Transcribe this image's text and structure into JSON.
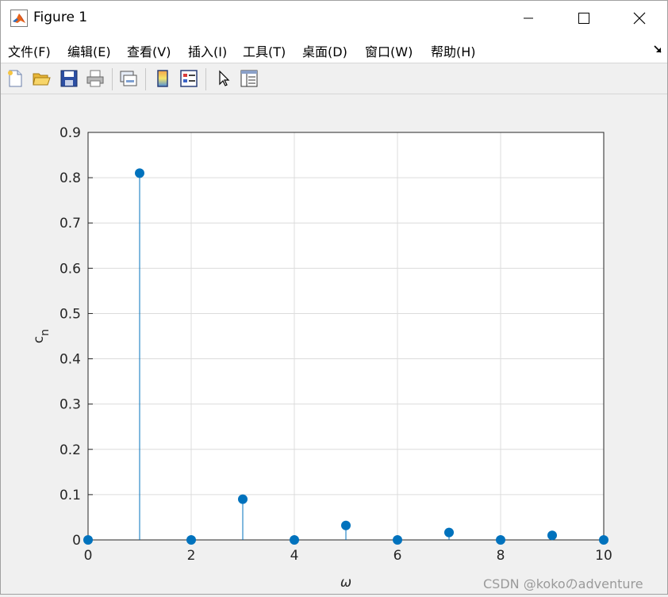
{
  "window": {
    "title": "Figure 1",
    "app_icon": "matlab-icon",
    "controls": {
      "minimize": "minimize-icon",
      "maximize": "maximize-icon",
      "close": "close-icon"
    }
  },
  "menubar": {
    "items": [
      {
        "label": "文件(F)"
      },
      {
        "label": "编辑(E)"
      },
      {
        "label": "查看(V)"
      },
      {
        "label": "插入(I)"
      },
      {
        "label": "工具(T)"
      },
      {
        "label": "桌面(D)"
      },
      {
        "label": "窗口(W)"
      },
      {
        "label": "帮助(H)"
      }
    ]
  },
  "toolbar": {
    "tools": [
      "new-figure-icon",
      "open-file-icon",
      "save-icon",
      "print-icon",
      "link-plot-icon",
      "colorbar-icon",
      "legend-icon",
      "edit-plot-arrow-icon",
      "property-inspector-icon"
    ]
  },
  "chart_data": {
    "type": "stem",
    "x": [
      0,
      1,
      2,
      3,
      4,
      5,
      6,
      7,
      8,
      9,
      10
    ],
    "y": [
      0,
      0.81,
      0,
      0.09,
      0,
      0.032,
      0,
      0.0165,
      0,
      0.01,
      0
    ],
    "xlabel": "ω",
    "ylabel": "c",
    "ylabel_subscript": "n",
    "xlim": [
      0,
      10
    ],
    "ylim": [
      0,
      0.9
    ],
    "xticks": [
      "0",
      "2",
      "4",
      "6",
      "8",
      "10"
    ],
    "yticks": [
      "0",
      "0.1",
      "0.2",
      "0.3",
      "0.4",
      "0.5",
      "0.6",
      "0.7",
      "0.8",
      "0.9"
    ],
    "grid": true,
    "marker": "filled-circle",
    "color": "#0072bd"
  },
  "watermark": "CSDN @kokoのadventure"
}
